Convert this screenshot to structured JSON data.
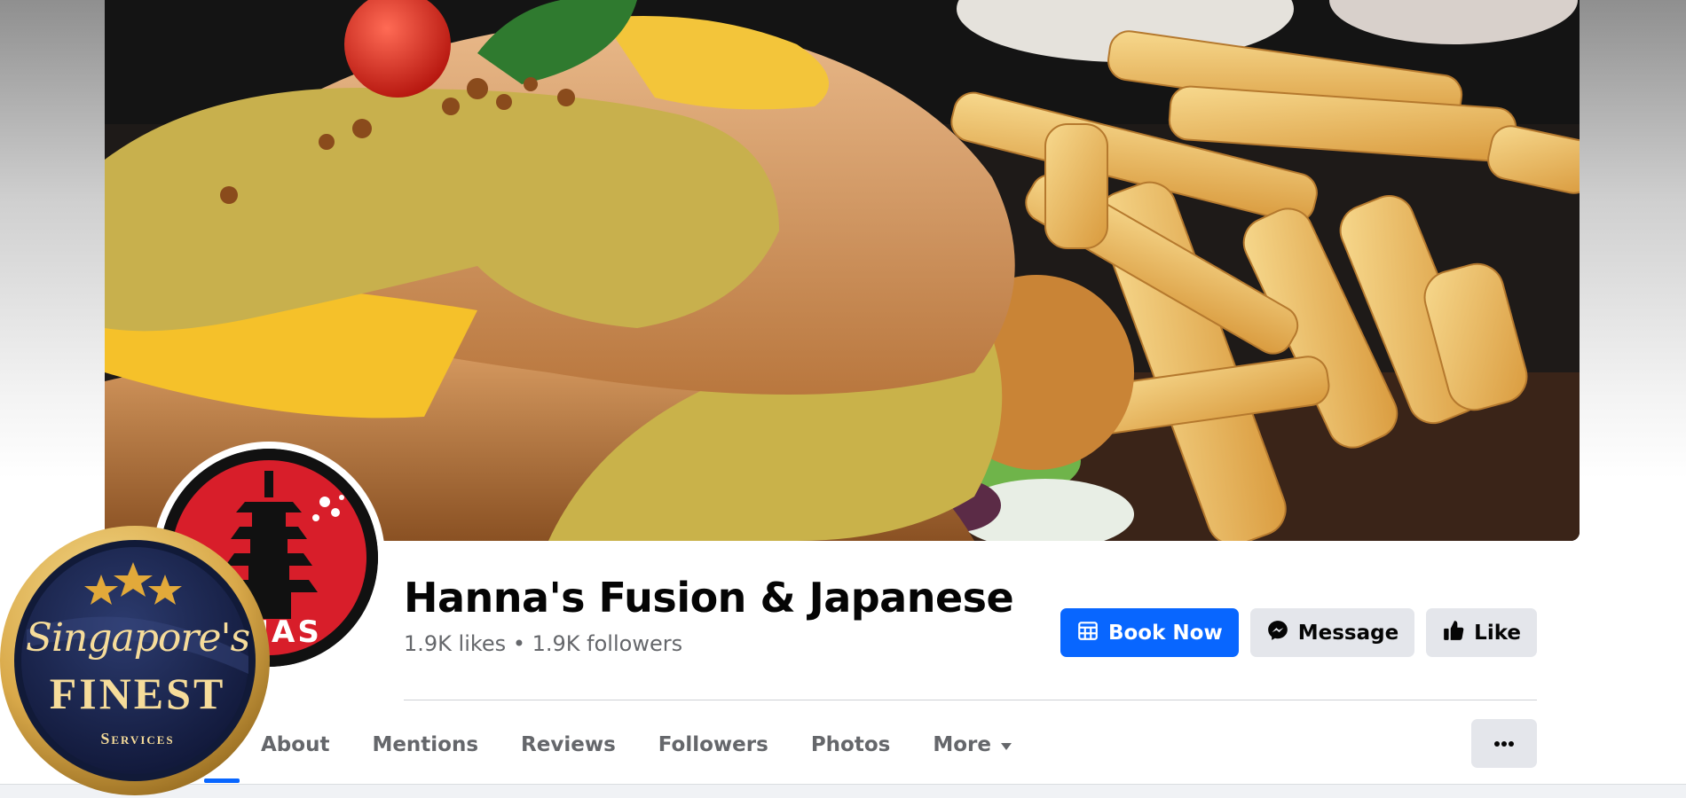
{
  "page": {
    "name": "Hanna's Fusion & Japanese",
    "likes": "1.9K likes",
    "separator": "•",
    "followers": "1.9K followers"
  },
  "actions": {
    "book_now": "Book Now",
    "message": "Message",
    "like": "Like"
  },
  "tabs": [
    {
      "label": "About"
    },
    {
      "label": "Mentions"
    },
    {
      "label": "Reviews"
    },
    {
      "label": "Followers"
    },
    {
      "label": "Photos"
    },
    {
      "label": "More"
    }
  ],
  "avatar": {
    "logo_text": "HNAS"
  },
  "badge": {
    "script_text": "Singapore's",
    "main_text": "FINEST",
    "sub_text": "Services"
  },
  "colors": {
    "primary_blue": "#0866ff",
    "secondary_gray": "#e4e6eb",
    "text_dark": "#050505",
    "text_muted": "#65676b",
    "logo_red": "#d81e2a",
    "badge_gold": "#d9a94a",
    "badge_navy": "#141d3d"
  },
  "icons": {
    "book_now": "calendar-icon",
    "message": "messenger-icon",
    "like": "thumbs-up-icon",
    "more": "caret-down-icon",
    "overflow": "ellipsis-icon"
  }
}
